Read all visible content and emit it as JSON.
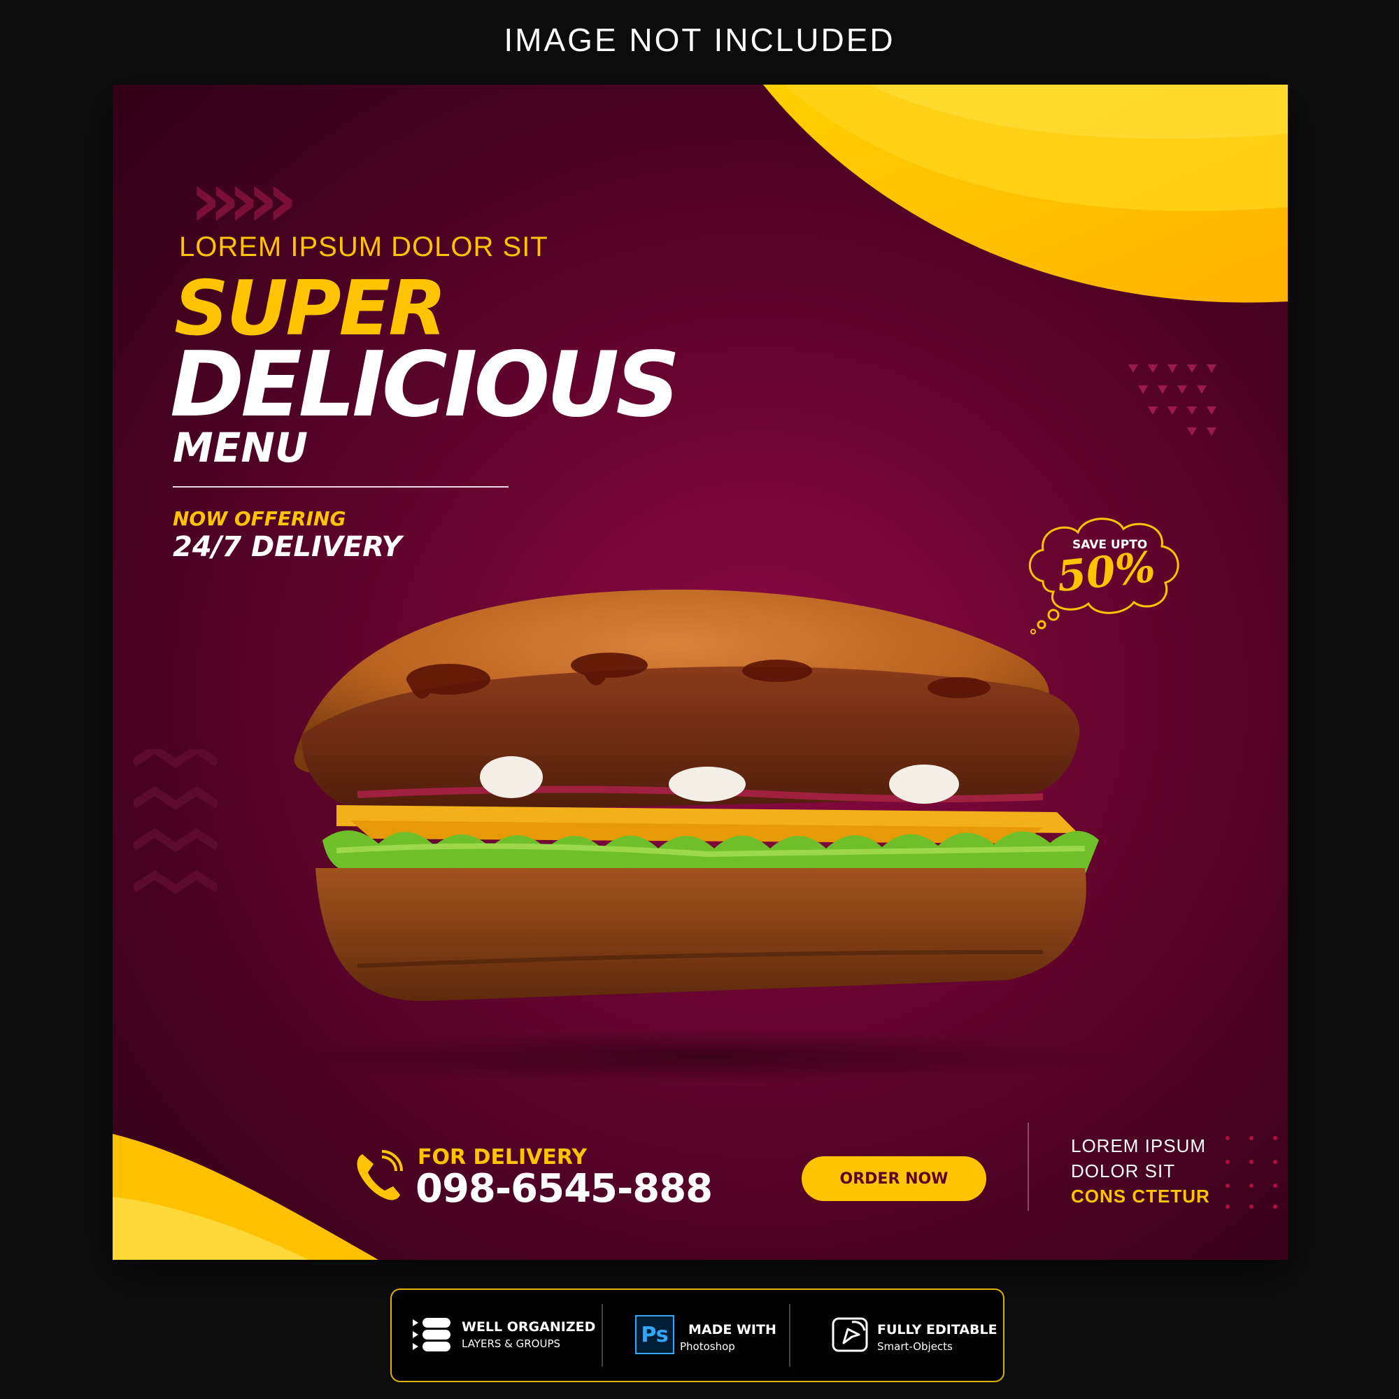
{
  "header": {
    "title": "IMAGE NOT INCLUDED"
  },
  "poster": {
    "eyebrow": "LOREM IPSUM DOLOR SIT",
    "headline_1": "SUPER",
    "headline_2": "DELICIOUS",
    "headline_3": "MENU",
    "offer_label": "NOW OFFERING",
    "offer_text": "24/7 DELIVERY",
    "badge": {
      "small": "SAVE UPTO",
      "value": "50%"
    },
    "contact": {
      "label": "FOR DELIVERY",
      "phone": "098-6545-888"
    },
    "cta_label": "ORDER NOW",
    "side_text": [
      "LOREM IPSUM",
      "DOLOR SIT",
      "CONS CTETUR"
    ],
    "colors": {
      "accent": "#ffc400",
      "background": "#6a0531"
    },
    "image": "sandwich-photo"
  },
  "features": [
    {
      "icon": "layers-icon",
      "title": "WELL ORGANIZED",
      "subtitle": "LAYERS & GROUPS"
    },
    {
      "icon": "photoshop-icon",
      "icon_text": "Ps",
      "title": "MADE WITH",
      "subtitle": "Photoshop"
    },
    {
      "icon": "smart-object-icon",
      "title": "FULLY EDITABLE",
      "subtitle": "Smart-Objects"
    }
  ]
}
